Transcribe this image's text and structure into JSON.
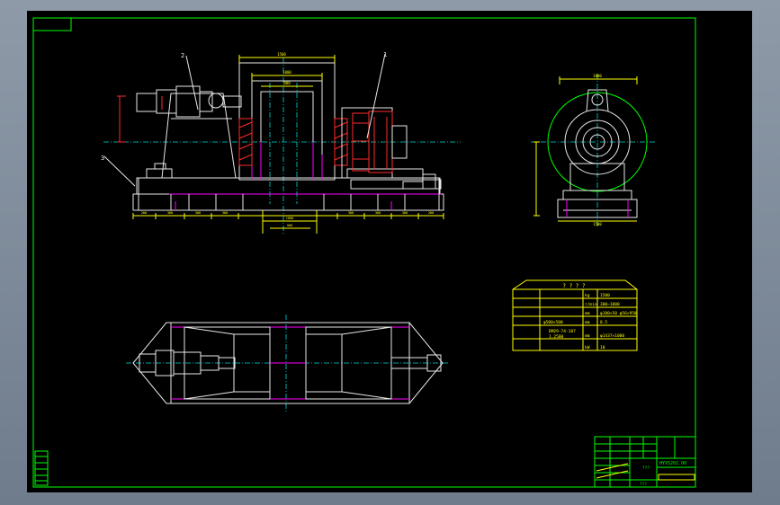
{
  "drawing": {
    "part_labels": {
      "p1": "1",
      "p2": "2",
      "p3": "3"
    },
    "spec_table": {
      "header": "? ? ? ?",
      "rows": [
        {
          "unit": "kg",
          "value": "1500"
        },
        {
          "unit": "r/min",
          "value": "300~1000"
        },
        {
          "unit": "mm",
          "value": "φ180×50 φ56×950"
        },
        {
          "unit": "mm",
          "value": "8.5"
        },
        {
          "unit": "mm",
          "value": "φ1437×1000"
        },
        {
          "unit": "kW",
          "value": "10"
        }
      ],
      "left_notes": [
        "φ500×500",
        "DM29-74-187",
        "1.2500"
      ]
    },
    "title_block": {
      "drawing_no": "HYX5202.00",
      "label_bottom": "???",
      "label_mid": "???"
    },
    "colors": {
      "frame": "#00ff00",
      "outline": "#e8e8e8",
      "dimension": "#ffff00",
      "center": "#00d8d8",
      "accent_magenta": "#ff00ff",
      "accent_red": "#ff2a2a"
    }
  }
}
